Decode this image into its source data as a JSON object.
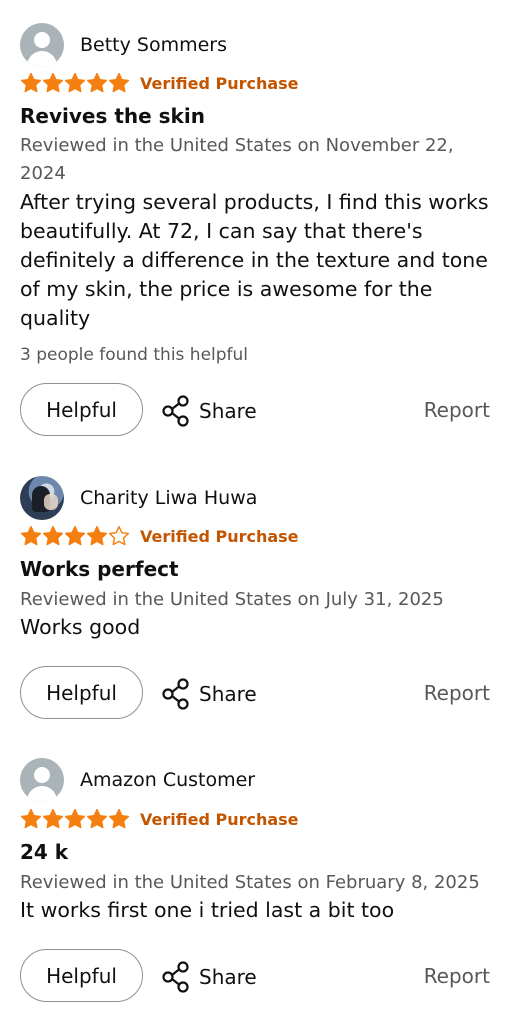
{
  "reviews": [
    {
      "name": "Betty Sommers",
      "rating": 5,
      "verified": "Verified Purchase",
      "title": "Revives the skin",
      "meta": "Reviewed in the United States on November 22, 2024",
      "body": "After trying several products, I find this works beautifully. At 72, I can say that there's definitely a difference in the texture and tone of my skin, the price is awesome for the quality",
      "helpful_count": "3 people found this helpful",
      "helpful_label": "Helpful",
      "share_label": "Share",
      "report_label": "Report"
    },
    {
      "name": "Charity Liwa Huwa",
      "rating": 4,
      "verified": "Verified Purchase",
      "title": "Works perfect",
      "meta": "Reviewed in the United States on July 31, 2025",
      "body": "Works good",
      "helpful_label": "Helpful",
      "share_label": "Share",
      "report_label": "Report"
    },
    {
      "name": "Amazon Customer",
      "rating": 5,
      "verified": "Verified Purchase",
      "title": "24 k",
      "meta": "Reviewed in the United States on February 8, 2025",
      "body": "It works first one i tried last a bit too",
      "helpful_label": "Helpful",
      "share_label": "Share",
      "report_label": "Report"
    }
  ],
  "colors": {
    "star": "#f47f10",
    "verified": "#c45500",
    "muted": "#565959",
    "text": "#0f1111"
  },
  "icons": {
    "avatar": "person-placeholder-icon",
    "share": "share-icon",
    "star": "star-icon"
  }
}
